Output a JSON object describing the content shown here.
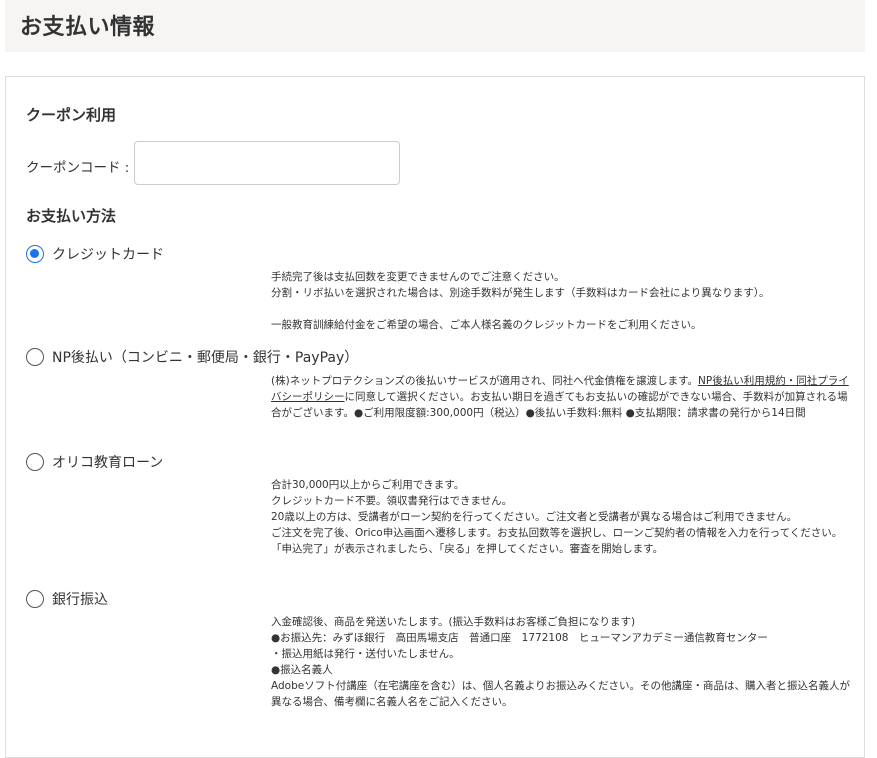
{
  "page": {
    "title": "お支払い情報"
  },
  "coupon": {
    "heading": "クーポン利用",
    "label": "クーポンコード :",
    "value": "",
    "placeholder": ""
  },
  "payment": {
    "heading": "お支払い方法",
    "accent_color": "#1a73e8",
    "options": [
      {
        "label": "クレジットカード",
        "checked": true,
        "lines": [
          "手続完了後は支払回数を変更できませんのでご注意ください。",
          "分割・リボ払いを選択された場合は、別途手数料が発生します（手数料はカード会社により異なります）。",
          "一般教育訓練給付金をご希望の場合、ご本人様名義のクレジットカードをご利用ください。"
        ]
      },
      {
        "label": "NP後払い（コンビニ・郵便局・銀行・PayPay）",
        "checked": false,
        "text_before": "(株)ネットプロテクションズの後払いサービスが適用され、同社へ代金債権を譲渡します。",
        "link_terms": "NP後払い利用規約・同社プライバシーポリシー",
        "text_after": "に同意して選択ください。お支払い期日を過ぎてもお支払いの確認ができない場合、手数料が加算される場合がございます。●ご利用限度額:300,000円（税込）●後払い手数料:無料 ●支払期限：請求書の発行から14日間"
      },
      {
        "label": "オリコ教育ローン",
        "checked": false,
        "lines": [
          "合計30,000円以上からご利用できます。",
          "クレジットカード不要。領収書発行はできません。",
          "20歳以上の方は、受講者がローン契約を行ってください。ご注文者と受講者が異なる場合はご利用できません。",
          "ご注文を完了後、Orico申込画面へ遷移します。お支払回数等を選択し、ローンご契約者の情報を入力を行ってください。",
          "「申込完了」が表示されましたら、「戻る」を押してください。審査を開始します。"
        ]
      },
      {
        "label": "銀行振込",
        "checked": false,
        "lines": [
          "入金確認後、商品を発送いたします。(振込手数料はお客様ご負担になります)",
          "●お振込先：みずほ銀行　高田馬場支店　普通口座　1772108　ヒューマンアカデミー通信教育センター",
          "・振込用紙は発行・送付いたしません。",
          "●振込名義人",
          "Adobeソフト付講座（在宅講座を含む）は、個人名義よりお振込みください。その他講座・商品は、購入者と振込名義人が異なる場合、備考欄に名義人名をご記入ください。"
        ]
      }
    ]
  }
}
